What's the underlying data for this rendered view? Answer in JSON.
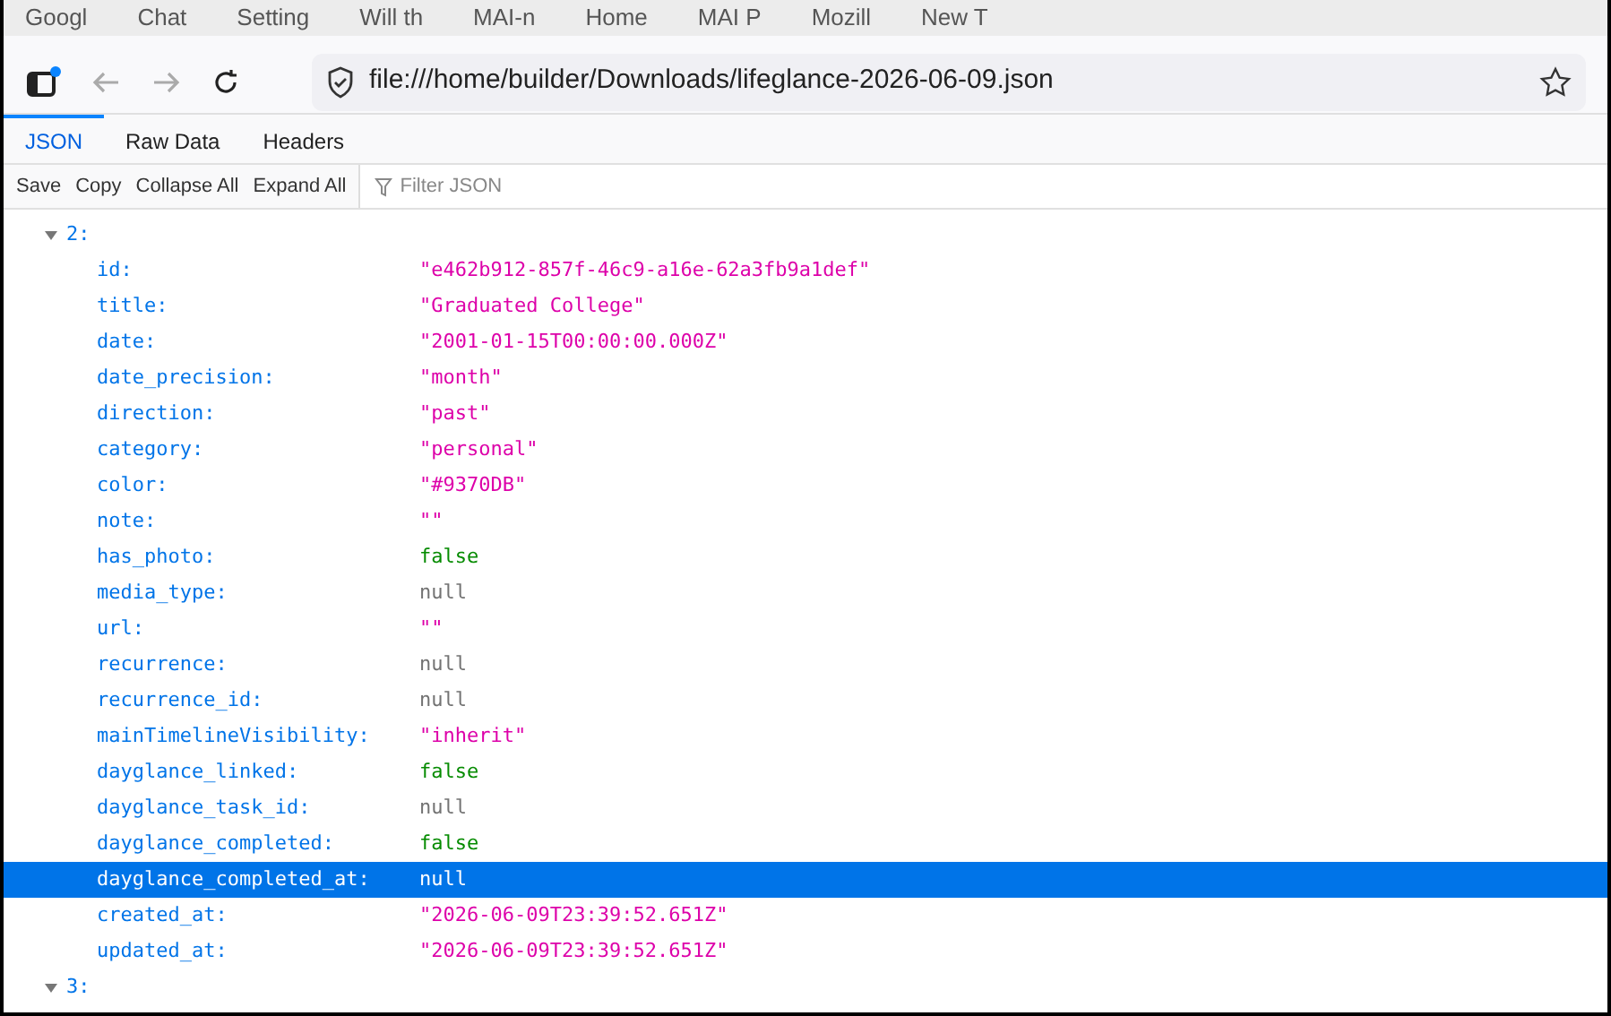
{
  "bookmarks": [
    "Googl",
    "Chat",
    "Setting",
    "Will th",
    "MAI-n",
    "Home",
    "MAI P",
    "Mozill",
    "New T"
  ],
  "address_bar": {
    "url": "file:///home/builder/Downloads/lifeglance-2026-06-09.json"
  },
  "tabs": [
    {
      "label": "JSON",
      "selected": true
    },
    {
      "label": "Raw Data",
      "selected": false
    },
    {
      "label": "Headers",
      "selected": false
    }
  ],
  "toolbar": {
    "buttons": [
      "Save",
      "Copy",
      "Collapse All",
      "Expand All"
    ],
    "filter_placeholder": "Filter JSON"
  },
  "tree": [
    {
      "key": "2:",
      "expanded": true,
      "children": [
        {
          "key": "id:",
          "value": "\"e462b912-857f-46c9-a16e-62a3fb9a1def\"",
          "kind": "string",
          "selected": false
        },
        {
          "key": "title:",
          "value": "\"Graduated College\"",
          "kind": "string",
          "selected": false
        },
        {
          "key": "date:",
          "value": "\"2001-01-15T00:00:00.000Z\"",
          "kind": "string",
          "selected": false
        },
        {
          "key": "date_precision:",
          "value": "\"month\"",
          "kind": "string",
          "selected": false
        },
        {
          "key": "direction:",
          "value": "\"past\"",
          "kind": "string",
          "selected": false
        },
        {
          "key": "category:",
          "value": "\"personal\"",
          "kind": "string",
          "selected": false
        },
        {
          "key": "color:",
          "value": "\"#9370DB\"",
          "kind": "string",
          "selected": false
        },
        {
          "key": "note:",
          "value": "\"\"",
          "kind": "string",
          "selected": false
        },
        {
          "key": "has_photo:",
          "value": "false",
          "kind": "boolean",
          "selected": false
        },
        {
          "key": "media_type:",
          "value": "null",
          "kind": "null",
          "selected": false
        },
        {
          "key": "url:",
          "value": "\"\"",
          "kind": "string",
          "selected": false
        },
        {
          "key": "recurrence:",
          "value": "null",
          "kind": "null",
          "selected": false
        },
        {
          "key": "recurrence_id:",
          "value": "null",
          "kind": "null",
          "selected": false
        },
        {
          "key": "mainTimelineVisibility:",
          "value": "\"inherit\"",
          "kind": "string",
          "selected": false
        },
        {
          "key": "dayglance_linked:",
          "value": "false",
          "kind": "boolean",
          "selected": false
        },
        {
          "key": "dayglance_task_id:",
          "value": "null",
          "kind": "null",
          "selected": false
        },
        {
          "key": "dayglance_completed:",
          "value": "false",
          "kind": "boolean",
          "selected": false
        },
        {
          "key": "dayglance_completed_at:",
          "value": "null",
          "kind": "null",
          "selected": true
        },
        {
          "key": "created_at:",
          "value": "\"2026-06-09T23:39:52.651Z\"",
          "kind": "string",
          "selected": false
        },
        {
          "key": "updated_at:",
          "value": "\"2026-06-09T23:39:52.651Z\"",
          "kind": "string",
          "selected": false
        }
      ]
    },
    {
      "key": "3:",
      "expanded": true
    }
  ]
}
